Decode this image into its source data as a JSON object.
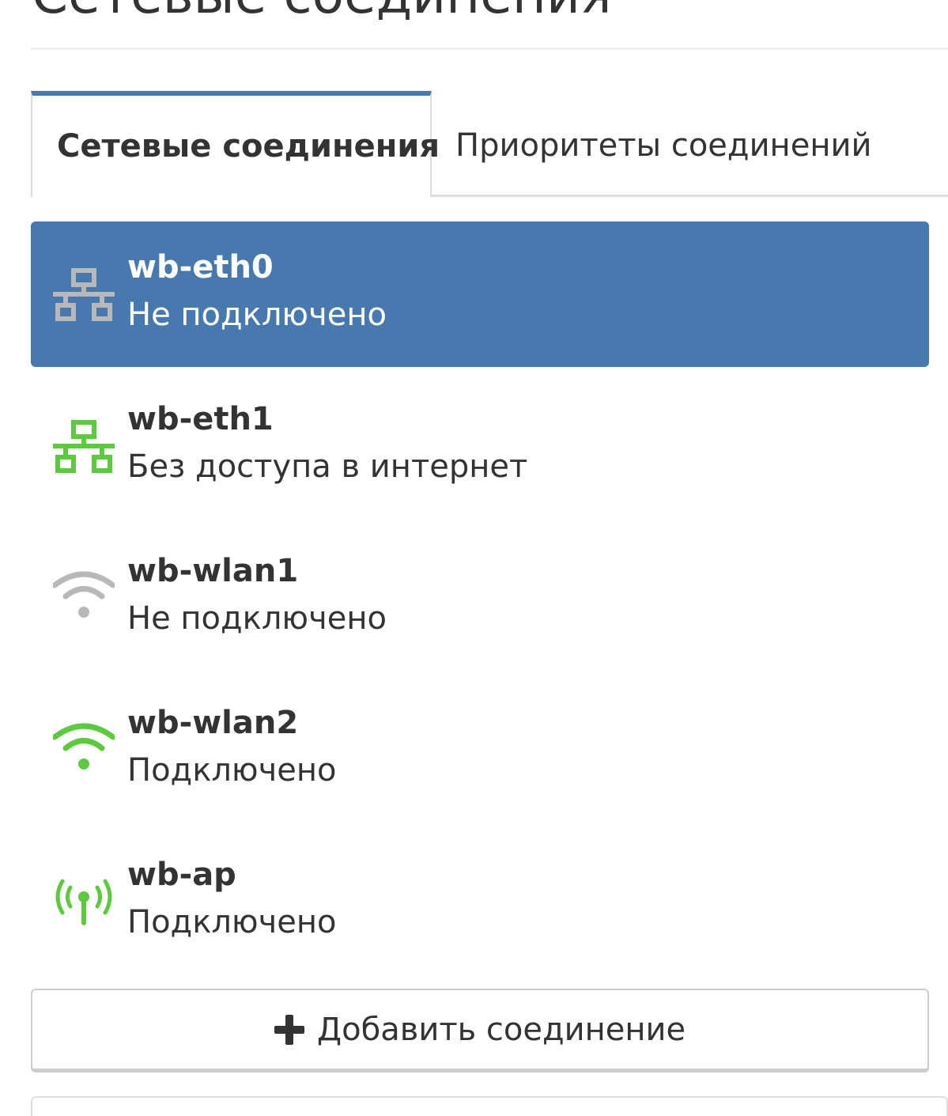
{
  "header": {
    "title": "Сетевые соединения"
  },
  "tabs": [
    {
      "label": "Сетевые соединения",
      "active": true
    },
    {
      "label": "Приоритеты соединений",
      "active": false
    }
  ],
  "connections": [
    {
      "name": "wb-eth0",
      "status": "Не подключено",
      "icon": "ethernet-icon",
      "icon_color": "#b8b8b8",
      "selected": true
    },
    {
      "name": "wb-eth1",
      "status": "Без доступа в интернет",
      "icon": "ethernet-icon",
      "icon_color": "#5cc93e",
      "selected": false
    },
    {
      "name": "wb-wlan1",
      "status": "Не подключено",
      "icon": "wifi-icon",
      "icon_color": "#b8b8b8",
      "selected": false
    },
    {
      "name": "wb-wlan2",
      "status": "Подключено",
      "icon": "wifi-icon",
      "icon_color": "#5cc93e",
      "selected": false
    },
    {
      "name": "wb-ap",
      "status": "Подключено",
      "icon": "access-point-icon",
      "icon_color": "#5cc93e",
      "selected": false
    }
  ],
  "add_button": {
    "label": "Добавить соединение",
    "icon": "plus-icon"
  },
  "colors": {
    "accent": "#4779af",
    "connected_green": "#5cc93e",
    "inactive_gray": "#b8b8b8"
  }
}
